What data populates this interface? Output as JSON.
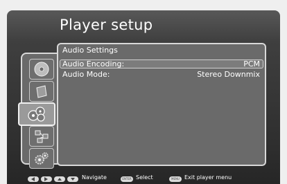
{
  "header": {
    "title": "Player setup"
  },
  "sidebar": {
    "items": [
      {
        "name": "disc",
        "icon": "disc-icon"
      },
      {
        "name": "display",
        "icon": "display-icon"
      },
      {
        "name": "audio",
        "icon": "audio-settings-icon",
        "active": true
      },
      {
        "name": "network",
        "icon": "network-icon"
      },
      {
        "name": "system",
        "icon": "gears-icon"
      }
    ]
  },
  "panel": {
    "title": "Audio Settings",
    "rows": [
      {
        "label": "Audio Encoding:",
        "value": "PCM",
        "selected": true
      },
      {
        "label": "Audio Mode:",
        "value": "Stereo Downmix",
        "selected": false
      }
    ]
  },
  "footer": {
    "navigate_label": "Navigate",
    "select_key": "ENTER",
    "select_label": "Select",
    "menu_key": "MENU",
    "exit_label": "Exit player menu"
  }
}
